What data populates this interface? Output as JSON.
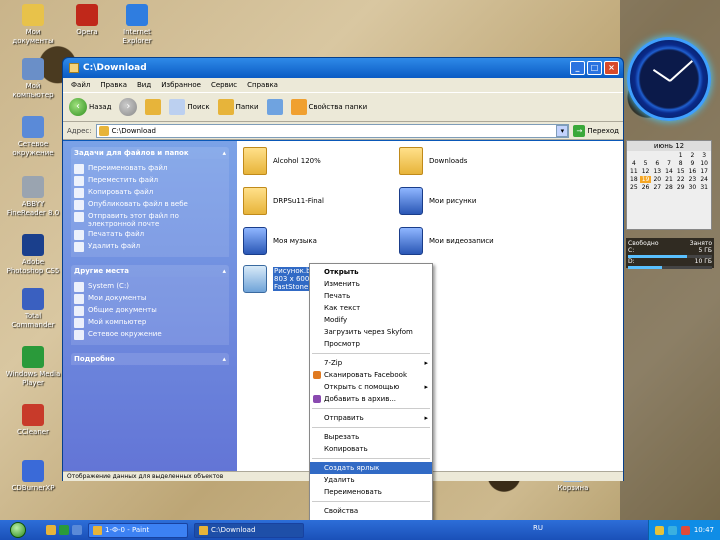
{
  "desktop": {
    "icons": [
      {
        "label": "Мои документы",
        "color": "#e8c24a"
      },
      {
        "label": "Opera",
        "color": "#c0281a"
      },
      {
        "label": "Internet Explorer",
        "color": "#2f7de0"
      },
      {
        "label": "Мой компьютер",
        "color": "#6a8fc8"
      },
      {
        "label": "Сетевое окружение",
        "color": "#5a8ad8"
      },
      {
        "label": "ABBYY FineReader 8.0",
        "color": "#9aa4b0"
      },
      {
        "label": "Adobe Photoshop CS5",
        "color": "#1a3f8c"
      },
      {
        "label": "Total Commander",
        "color": "#3a60c0"
      },
      {
        "label": "Windows Media Player",
        "color": "#2a9a3a"
      },
      {
        "label": "CCleaner",
        "color": "#c83a2a"
      },
      {
        "label": "CDBurnerXP",
        "color": "#3a6ad8"
      },
      {
        "label": "Корзина",
        "color": "#9ab8d8"
      }
    ]
  },
  "window": {
    "title": "C:\\Download",
    "menu": [
      "Файл",
      "Правка",
      "Вид",
      "Избранное",
      "Сервис",
      "Справка"
    ],
    "toolbar": {
      "back": "Назад",
      "search": "Поиск",
      "folders": "Папки",
      "special": "Свойства папки"
    },
    "address": {
      "label": "Адрес:",
      "value": "C:\\Download",
      "go": "Переход"
    },
    "left_panels": [
      {
        "title": "Задачи для файлов и папок",
        "items": [
          "Переименовать файл",
          "Переместить файл",
          "Копировать файл",
          "Опубликовать файл в вебе",
          "Отправить этот файл по электронной почте",
          "Печатать файл",
          "Удалить файл"
        ]
      },
      {
        "title": "Другие места",
        "items": [
          "System (C:)",
          "Мои документы",
          "Общие документы",
          "Мой компьютер",
          "Сетевое окружение"
        ]
      },
      {
        "title": "Подробно",
        "items": []
      }
    ],
    "files": [
      {
        "name": "Alcohol 120%",
        "kind": "folder"
      },
      {
        "name": "Downloads",
        "kind": "folder"
      },
      {
        "name": "DRPSu11-Final",
        "kind": "folder"
      },
      {
        "name": "Мои рисунки",
        "kind": "special"
      },
      {
        "name": "Моя музыка",
        "kind": "special"
      },
      {
        "name": "Мои видеозаписи",
        "kind": "special"
      },
      {
        "name": "Рисунок.bmp 803 x 600 FastStone",
        "kind": "image"
      }
    ],
    "status": "Отображение данных для выделенных объектов"
  },
  "context_menu": {
    "items": [
      {
        "label": "Открыть",
        "bold": true
      },
      {
        "label": "Изменить"
      },
      {
        "label": "Печать"
      },
      {
        "label": "Как текст"
      },
      {
        "label": "Modify"
      },
      {
        "label": "Загрузить через Skyfom"
      },
      {
        "label": "Просмотр"
      },
      {
        "sep": true
      },
      {
        "label": "7-Zip",
        "sub": true
      },
      {
        "label": "Сканировать Facebook",
        "icon": "#e07a20"
      },
      {
        "label": "Открыть с помощью",
        "sub": true
      },
      {
        "label": "Добавить в архив...",
        "icon": "#8a4ab0"
      },
      {
        "sep": true
      },
      {
        "label": "Отправить",
        "sub": true
      },
      {
        "sep": true
      },
      {
        "label": "Вырезать"
      },
      {
        "label": "Копировать"
      },
      {
        "sep": true
      },
      {
        "label": "Создать ярлык",
        "highlight": true
      },
      {
        "label": "Удалить"
      },
      {
        "label": "Переименовать"
      },
      {
        "sep": true
      },
      {
        "label": "Свойства"
      }
    ]
  },
  "gadgets": {
    "clock_hands": {
      "hour": 10,
      "minute": 8
    },
    "calendar": {
      "header": "июнь 12",
      "days": [
        "",
        "",
        "",
        "",
        "1",
        "2",
        "3",
        "4",
        "5",
        "6",
        "7",
        "8",
        "9",
        "10",
        "11",
        "12",
        "13",
        "14",
        "15",
        "16",
        "17",
        "18",
        "19",
        "20",
        "21",
        "22",
        "23",
        "24",
        "25",
        "26",
        "27",
        "28",
        "29",
        "30",
        "31"
      ],
      "today": "19"
    },
    "drives": {
      "header_free": "Свободно",
      "header_used": "Занято",
      "rows": [
        {
          "name": "C:",
          "value": "5 ГБ",
          "fraction": 0.7
        },
        {
          "name": "D:",
          "value": "10 ГБ",
          "fraction": 0.4
        }
      ]
    }
  },
  "taskbar": {
    "tasks": [
      "1-Ф-0 - Paint",
      "C:\\Download"
    ],
    "lang": "RU",
    "time": "10:47"
  }
}
